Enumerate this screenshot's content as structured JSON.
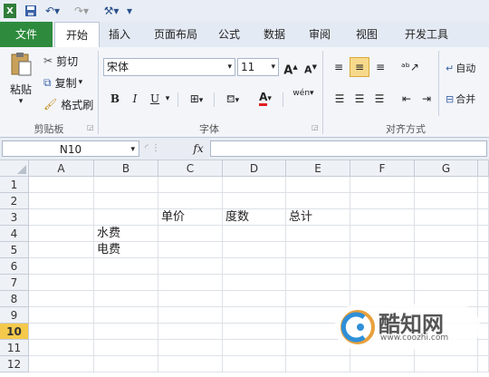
{
  "tabs": {
    "file": "文件",
    "items": [
      "开始",
      "插入",
      "页面布局",
      "公式",
      "数据",
      "审阅",
      "视图",
      "开发工具"
    ]
  },
  "clipboard": {
    "paste": "粘贴",
    "cut": "剪切",
    "copy": "复制",
    "format_painter": "格式刷",
    "group": "剪贴板"
  },
  "font": {
    "name": "宋体",
    "size": "11",
    "group": "字体",
    "bold": "B",
    "italic": "I",
    "underline": "U",
    "grow": "A",
    "shrink": "A",
    "font_color": "A",
    "phonetic": "wén"
  },
  "alignment": {
    "group": "对齐方式",
    "wrap": "自动",
    "merge": "合并"
  },
  "formula_bar": {
    "name_box": "N10",
    "fx": "fx",
    "value": ""
  },
  "columns": [
    "A",
    "B",
    "C",
    "D",
    "E",
    "F",
    "G"
  ],
  "rows": [
    "1",
    "2",
    "3",
    "4",
    "5",
    "6",
    "7",
    "8",
    "9",
    "10",
    "11",
    "12"
  ],
  "selected_row": "10",
  "cells": {
    "C3": "单价",
    "D3": "度数",
    "E3": "总计",
    "B4": "水费",
    "B5": "电费"
  },
  "watermark": {
    "brand": "酷知网",
    "url": "www.coozhi.com"
  },
  "colors": {
    "file_tab": "#2e8b3e",
    "selected_row_header": "#f5c94b",
    "font_color_underline": "#e02020"
  }
}
